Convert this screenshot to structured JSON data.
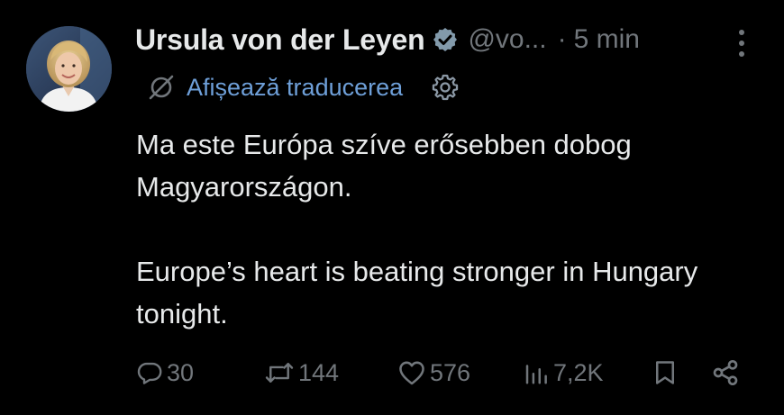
{
  "author": {
    "display_name": "Ursula von der Leyen",
    "handle": "@vo...",
    "separator": "·",
    "time": "5 min",
    "verified_badge": "verified-badge-icon",
    "avatar": "profile-photo"
  },
  "translate": {
    "label": "Afișează traducerea",
    "icon": "translate-icon",
    "settings_icon": "gear-icon"
  },
  "tweet": {
    "paragraph_1": "Ma este Európa szíve erősebben dobog Magyarországon.",
    "paragraph_2": "Europe’s heart is beating stronger in Hungary tonight."
  },
  "actions": {
    "replies": "30",
    "reposts": "144",
    "likes": "576",
    "views": "7,2K"
  },
  "colors": {
    "background": "#000000",
    "text": "#e7e9ea",
    "muted": "#71767b",
    "link": "#6e9fd8"
  }
}
